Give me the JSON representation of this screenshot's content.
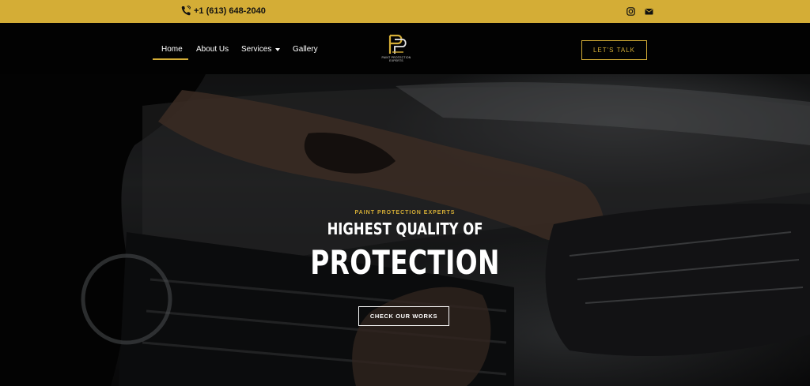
{
  "topbar": {
    "phone": "+1 (613) 648-2040",
    "icons": [
      "phone-icon",
      "instagram-icon",
      "envelope-icon"
    ],
    "background": "#d4ad36"
  },
  "nav": {
    "items": [
      {
        "label": "Home",
        "active": true
      },
      {
        "label": "About Us"
      },
      {
        "label": "Services",
        "has_dropdown": true
      },
      {
        "label": "Gallery"
      }
    ],
    "logo_text": "PAINT PROTECTION EXPERTS",
    "cta": "LET'S TALK"
  },
  "hero": {
    "kicker": "PAINT PROTECTION EXPERTS",
    "title_line1": "HIGHEST QUALITY OF",
    "title_line2": "PROTECTION",
    "button": "CHECK OUR WORKS"
  },
  "colors": {
    "accent": "#d4ad36",
    "header_bg": "#020202"
  }
}
